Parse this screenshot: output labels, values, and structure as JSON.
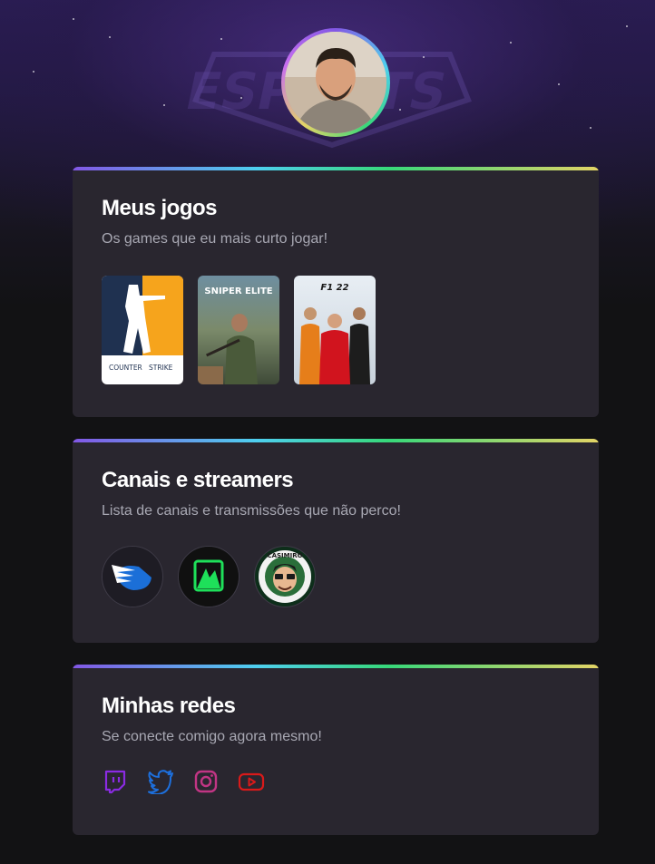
{
  "profile": {
    "avatar_alt": "Foto de perfil"
  },
  "games_card": {
    "title": "Meus jogos",
    "subtitle": "Os games que eu mais curto jogar!",
    "games": [
      {
        "name": "Counter Strike",
        "cover_text_1": "COUNTER",
        "cover_text_2": "STRIKE"
      },
      {
        "name": "Sniper Elite 5",
        "cover_text_1": "SNIPER ELITE"
      },
      {
        "name": "F1 22",
        "cover_text_1": "F1 22"
      }
    ]
  },
  "channels_card": {
    "title": "Canais e streamers",
    "subtitle": "Lista de canais e transmissões que não perco!",
    "channels": [
      {
        "icon": "wing-logo-icon"
      },
      {
        "icon": "green-logo-icon"
      },
      {
        "name": "CASIMIRO",
        "icon": "casimiro-logo-icon"
      }
    ]
  },
  "social_card": {
    "title": "Minhas redes",
    "subtitle": "Se conecte comigo agora mesmo!",
    "links": [
      {
        "icon": "twitch-icon",
        "color": "#8a2be2"
      },
      {
        "icon": "twitter-icon",
        "color": "#1d6fdc"
      },
      {
        "icon": "instagram-icon",
        "color": "#c13584"
      },
      {
        "icon": "youtube-icon",
        "color": "#d91a1a"
      }
    ]
  }
}
